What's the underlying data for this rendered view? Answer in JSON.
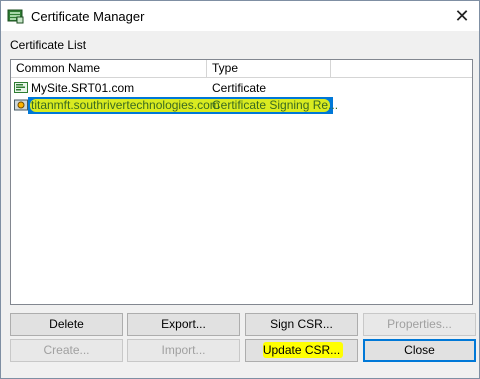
{
  "window": {
    "title": "Certificate Manager",
    "close_label": "✕"
  },
  "group_label": "Certificate List",
  "list": {
    "columns": [
      "Common Name",
      "Type",
      ""
    ],
    "rows": [
      {
        "name": "MySite.SRT01.com",
        "type": "Certificate",
        "icon": "certificate-icon",
        "selected": false
      },
      {
        "name": "titanmft.southrivertechnologies.com",
        "type": "Certificate Signing Re...",
        "icon": "csr-icon",
        "selected": true
      }
    ]
  },
  "buttons": {
    "delete": "Delete",
    "export": "Export...",
    "sign_csr": "Sign CSR...",
    "properties": "Properties...",
    "create": "Create...",
    "import": "Import...",
    "update_csr": "Update CSR...",
    "close": "Close"
  },
  "colors": {
    "selection": "#0078d7",
    "highlight": "#ffff00"
  }
}
